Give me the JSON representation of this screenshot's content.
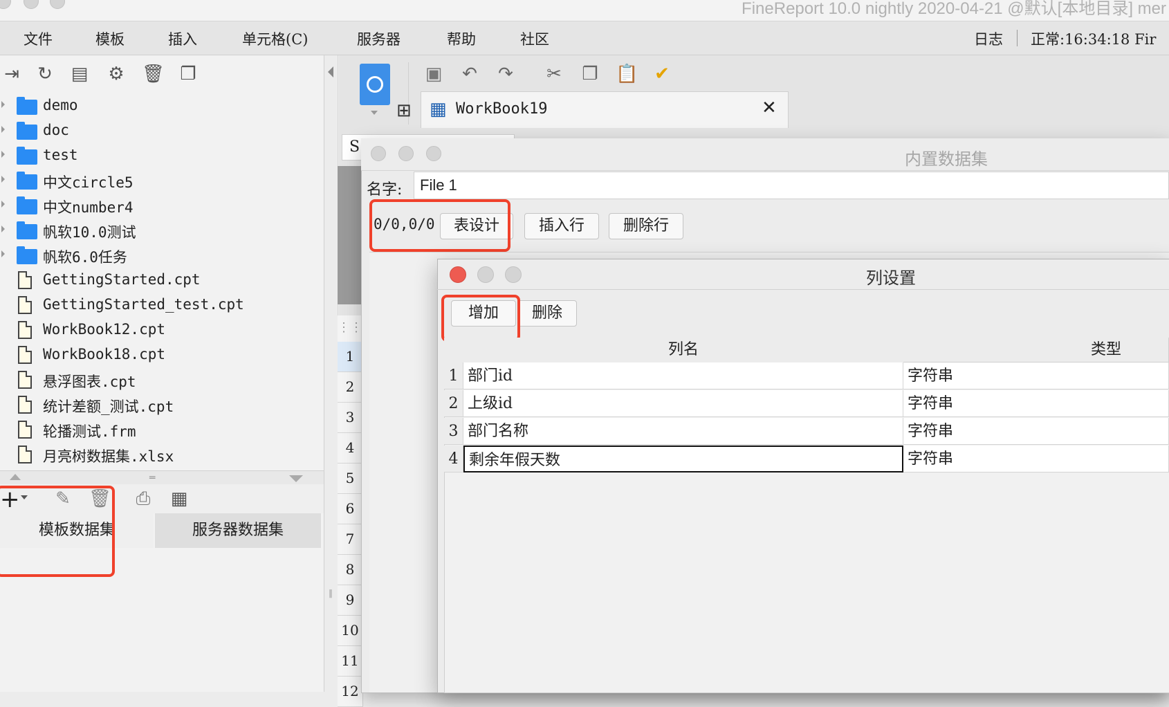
{
  "window": {
    "title": "FineReport 10.0 nightly 2020-04-21 @默认[本地目录]   mer"
  },
  "menu": [
    "文件",
    "模板",
    "插入",
    "单元格(C)",
    "服务器",
    "帮助",
    "社区"
  ],
  "status": {
    "log": "日志",
    "text": "正常:16:34:18 Fir"
  },
  "tree": [
    {
      "type": "folder",
      "name": "demo"
    },
    {
      "type": "folder",
      "name": "doc"
    },
    {
      "type": "folder",
      "name": "test"
    },
    {
      "type": "folder",
      "name": "中文circle5"
    },
    {
      "type": "folder",
      "name": "中文number4"
    },
    {
      "type": "folder",
      "name": "帆软10.0测试"
    },
    {
      "type": "folder",
      "name": "帆软6.0任务"
    },
    {
      "type": "file",
      "name": "GettingStarted.cpt"
    },
    {
      "type": "file",
      "name": "GettingStarted_test.cpt"
    },
    {
      "type": "file",
      "name": "WorkBook12.cpt"
    },
    {
      "type": "file",
      "name": "WorkBook18.cpt"
    },
    {
      "type": "file",
      "name": "悬浮图表.cpt"
    },
    {
      "type": "file",
      "name": "统计差额_测试.cpt"
    },
    {
      "type": "file",
      "name": "轮播测试.frm"
    },
    {
      "type": "file",
      "name": "月亮树数据集.xlsx"
    }
  ],
  "dataset_tabs": [
    "模板数据集",
    "服务器数据集"
  ],
  "editor": {
    "tab_name": "WorkBook19",
    "sheet_cell": "S",
    "row_numbers": [
      "1",
      "2",
      "3",
      "4",
      "5",
      "6",
      "7",
      "8",
      "9",
      "10",
      "11",
      "12"
    ]
  },
  "builtin_dialog": {
    "title": "内置数据集",
    "name_label": "名字:",
    "name_value": "File 1",
    "position": "0/0,0/0",
    "buttons": [
      "表设计",
      "插入行",
      "删除行"
    ]
  },
  "column_dialog": {
    "title": "列设置",
    "add_label": "增加",
    "delete_label": "删除",
    "headers": [
      "列名",
      "类型"
    ],
    "rows": [
      {
        "num": "1",
        "name": "部门id",
        "type": "字符串"
      },
      {
        "num": "2",
        "name": "上级id",
        "type": "字符串"
      },
      {
        "num": "3",
        "name": "部门名称",
        "type": "字符串"
      },
      {
        "num": "4",
        "name": "剩余年假天数",
        "type": "字符串"
      }
    ]
  },
  "colors": {
    "highlight": "#f0412b",
    "folder": "#2a8cf4",
    "close_button": "#ee5b51"
  }
}
